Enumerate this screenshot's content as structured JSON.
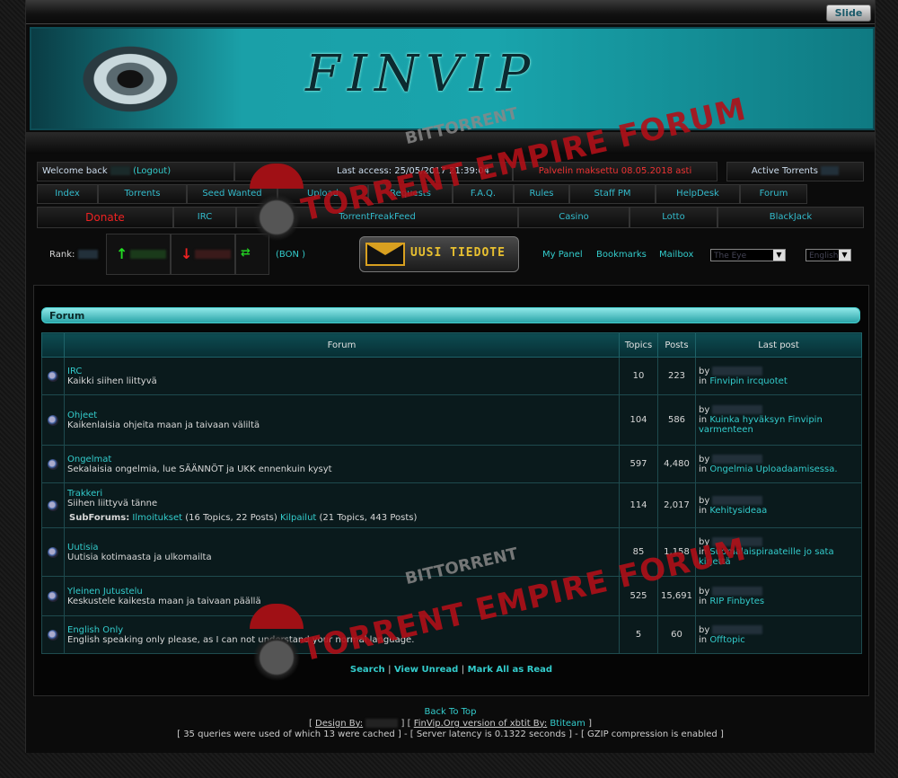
{
  "topbar": {
    "slide_label": "Slide"
  },
  "banner": {
    "logo_text": "FINVIP"
  },
  "welcome": {
    "welcome_text": "Welcome back",
    "logout_label": "(Logout)",
    "last_access": "Last access: 25/05/2017 21:39:04",
    "paid_notice": "Palvelin maksettu 08.05.2018 asti",
    "active_torrents": "Active Torrents"
  },
  "nav_row1": [
    "Index",
    "Torrents",
    "Seed Wanted",
    "Upload",
    "Requests",
    "F.A.Q.",
    "Rules",
    "Staff PM",
    "HelpDesk",
    "Forum"
  ],
  "nav_row2": [
    "Donate",
    "IRC",
    "TorrentFreakFeed",
    "Casino",
    "Lotto",
    "BlackJack"
  ],
  "toolbar": {
    "rank_label": "Rank:",
    "bonus_label": "(BON      )",
    "tiedote_label": "UUSI TIEDOTE",
    "my_panel": "My Panel",
    "bookmarks": "Bookmarks",
    "mailbox": "Mailbox",
    "style_select": "The Eye",
    "language_select": "English"
  },
  "forum": {
    "header": "Forum",
    "columns": [
      "",
      "Forum",
      "Topics",
      "Posts",
      "Last post"
    ],
    "rows": [
      {
        "name": "IRC",
        "desc": "Kaikki siihen liittyvä",
        "topics": "10",
        "posts": "223",
        "by": "by",
        "in": "in",
        "last_topic": "Finvipin ircquotet"
      },
      {
        "name": "Ohjeet",
        "desc": "Kaikenlaisia ohjeita maan ja taivaan väliltä",
        "topics": "104",
        "posts": "586",
        "by": "by",
        "in": "in",
        "last_topic": "Kuinka hyväksyn Finvipin varmenteen"
      },
      {
        "name": "Ongelmat",
        "desc": "Sekalaisia ongelmia, lue SÄÄNNÖT ja UKK ennenkuin kysyt",
        "topics": "597",
        "posts": "4,480",
        "by": "by",
        "in": "in",
        "last_topic": "Ongelmia Uploadaamisessa."
      },
      {
        "name": "Trakkeri",
        "desc": "Siihen liittyvä tänne",
        "subforums_label": "SubForums:",
        "sub1": "Ilmoitukset",
        "sub1_info": "(16 Topics, 22 Posts)",
        "sub2": "Kilpailut",
        "sub2_info": "(21 Topics, 443 Posts)",
        "topics": "114",
        "posts": "2,017",
        "by": "by",
        "in": "in",
        "last_topic": "Kehitysideaa"
      },
      {
        "name": "Uutisia",
        "desc": "Uutisia kotimaasta ja ulkomailta",
        "topics": "85",
        "posts": "1,158",
        "by": "by",
        "in": "in",
        "last_topic": "Suomalaispiraateille jo sata kirjettä"
      },
      {
        "name": "Yleinen Jutustelu",
        "desc": "Keskustele kaikesta maan ja taivaan päällä",
        "topics": "525",
        "posts": "15,691",
        "by": "by",
        "in": "in",
        "last_topic": "RIP Finbytes"
      },
      {
        "name": "English Only",
        "desc": "English speaking only please, as I can not understand your normal language.",
        "topics": "5",
        "posts": "60",
        "by": "by",
        "in": "in",
        "last_topic": "Offtopic"
      }
    ],
    "bottom_links": {
      "search": "Search",
      "sep": "|",
      "view_unread": "View Unread",
      "mark_all": "Mark All as Read"
    }
  },
  "footer": {
    "back_to_top": "Back To Top",
    "design_open": "[",
    "design_by": "Design By:",
    "design_mid": "]  [",
    "version": "FinVip.Org version of xbtit By:",
    "team": "Btiteam",
    "design_close": "]",
    "stats": "[ 35 queries were used of which 13 were cached ] - [ Server latency is 0.1322 seconds ] - [ GZIP compression is enabled ]"
  },
  "watermark": {
    "line1": "BITTORRENT",
    "line2": "TORRENT EMPIRE FORUM"
  },
  "colors": {
    "accent": "#33cccc",
    "banner": "#19a4ac",
    "alert": "#ee3333"
  }
}
